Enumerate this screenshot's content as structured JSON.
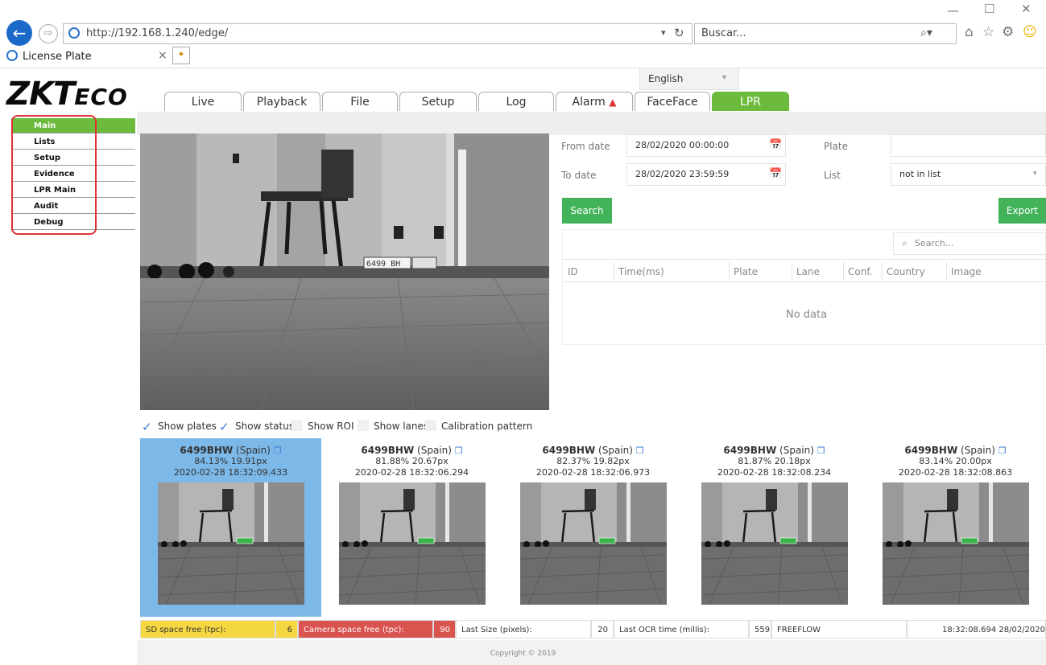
{
  "browser": {
    "url": "http://192.168.1.240/edge/",
    "search_placeholder": "Buscar...",
    "tab_title": "License Plate",
    "win_controls": [
      "—",
      "☐",
      "✕"
    ]
  },
  "header": {
    "logo_main": "ZKT",
    "logo_eco": "ECO",
    "language": "English",
    "nav_tabs": [
      "Live",
      "Playback",
      "File",
      "Setup",
      "Log",
      "Alarm",
      "FaceFace",
      "LPR"
    ],
    "active_tab": "LPR"
  },
  "sidebar": {
    "items": [
      "Main",
      "Lists",
      "Setup",
      "Evidence",
      "LPR Main",
      "Audit",
      "Debug"
    ],
    "active": "Main"
  },
  "video": {
    "plate_overlay": "6499 BH"
  },
  "checkboxes": [
    {
      "label": "Show plates",
      "checked": true
    },
    {
      "label": "Show status",
      "checked": true
    },
    {
      "label": "Show ROI",
      "checked": false
    },
    {
      "label": "Show lanes",
      "checked": false
    },
    {
      "label": "Calibration pattern",
      "checked": false
    }
  ],
  "search": {
    "from_label": "From date",
    "from_value": "28/02/2020 00:00:00",
    "to_label": "To date",
    "to_value": "28/02/2020 23:59:59",
    "plate_label": "Plate",
    "plate_value": "",
    "list_label": "List",
    "list_value": "not in list",
    "search_button": "Search",
    "export_button": "Export",
    "table_search_placeholder": "Search...",
    "columns": [
      "ID",
      "Time(ms)",
      "Plate",
      "Lane",
      "Conf.",
      "Country",
      "Image"
    ],
    "empty_text": "No data"
  },
  "thumbnails": [
    {
      "plate": "6499BHW",
      "country": "(Spain)",
      "stats": "84.13% 19.91px",
      "time": "2020-02-28 18:32:09.433",
      "selected": true
    },
    {
      "plate": "6499BHW",
      "country": "(Spain)",
      "stats": "81.88% 20.67px",
      "time": "2020-02-28 18:32:06.294",
      "selected": false
    },
    {
      "plate": "6499BHW",
      "country": "(Spain)",
      "stats": "82.37% 19.82px",
      "time": "2020-02-28 18:32:06.973",
      "selected": false
    },
    {
      "plate": "6499BHW",
      "country": "(Spain)",
      "stats": "81.87% 20.18px",
      "time": "2020-02-28 18:32:08.234",
      "selected": false
    },
    {
      "plate": "6499BHW",
      "country": "(Spain)",
      "stats": "83.14% 20.00px",
      "time": "2020-02-28 18:32:08.863",
      "selected": false
    }
  ],
  "status_bar": {
    "sd_label": "SD space free (tpc):",
    "sd_value": "6",
    "cam_label": "Camera space free (tpc):",
    "cam_value": "90",
    "size_label": "Last Size (pixels):",
    "size_value": "20",
    "ocr_label": "Last OCR time (millis):",
    "ocr_value": "559",
    "mode": "FREEFLOW",
    "timestamp": "18:32:08.694 28/02/2020"
  },
  "footer": {
    "copyright": "Copyright © 2019"
  },
  "colors": {
    "accent_green": "#6cbb3c",
    "button_green": "#43b35a",
    "selected_blue": "#7cb8e8",
    "sd_yellow": "#f5d742",
    "cam_red": "#d9534f",
    "highlight_red": "#dd3333"
  }
}
